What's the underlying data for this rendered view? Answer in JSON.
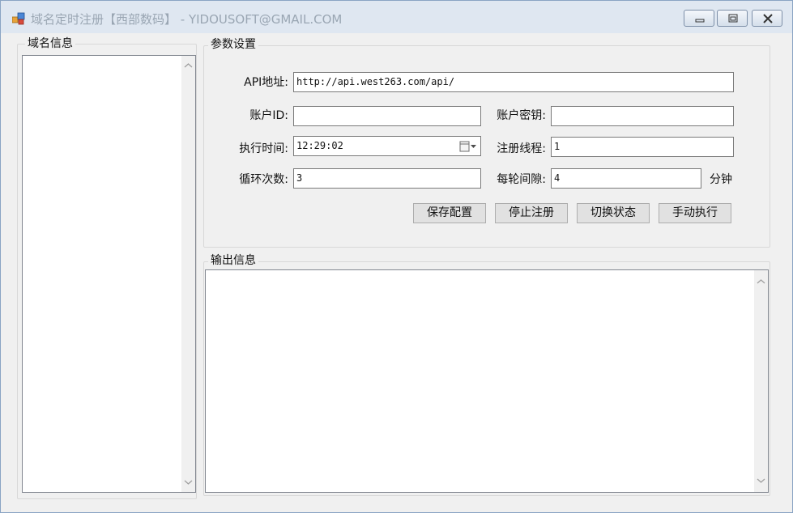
{
  "window": {
    "title": "域名定时注册【西部数码】 - YIDOUSOFT@GMAIL.COM",
    "icon": "app-window-icon",
    "controls": [
      "minimize-icon",
      "maximize-icon",
      "close-icon"
    ]
  },
  "domain_panel": {
    "title": "域名信息",
    "items": []
  },
  "settings": {
    "title": "参数设置",
    "api_label": "API地址:",
    "api_value": "http://api.west263.com/api/",
    "account_id_label": "账户ID:",
    "account_id_value": "",
    "account_key_label": "账户密钥:",
    "account_key_value": "",
    "exec_time_label": "执行时间:",
    "exec_time_value": "12:29:02",
    "threads_label": "注册线程:",
    "threads_value": "1",
    "loops_label": "循环次数:",
    "loops_value": "3",
    "interval_label": "每轮间隙:",
    "interval_value": "4",
    "interval_unit": "分钟",
    "buttons": {
      "save": "保存配置",
      "stop": "停止注册",
      "toggle": "切换状态",
      "manual": "手动执行"
    }
  },
  "output_panel": {
    "title": "输出信息",
    "text": ""
  },
  "colors": {
    "titlebar": "#dfe7f1",
    "window_bg": "#f0f0f0",
    "title_text": "#9aa6b3"
  }
}
